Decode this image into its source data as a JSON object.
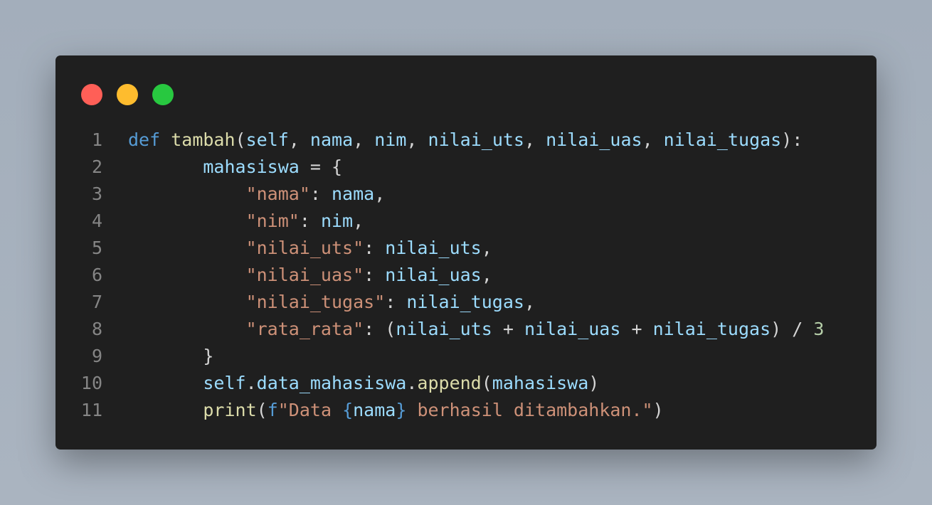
{
  "window": {
    "traffic_lights": {
      "close_color": "#ff5f57",
      "minimize_color": "#febc2e",
      "maximize_color": "#28c840"
    }
  },
  "editor": {
    "lines": [
      {
        "number": "1",
        "indent": "",
        "tokens": [
          {
            "text": "def",
            "type": "kw"
          },
          {
            "text": " ",
            "type": "pn"
          },
          {
            "text": "tambah",
            "type": "fn"
          },
          {
            "text": "(",
            "type": "pn"
          },
          {
            "text": "self",
            "type": "var"
          },
          {
            "text": ", ",
            "type": "pn"
          },
          {
            "text": "nama",
            "type": "var"
          },
          {
            "text": ", ",
            "type": "pn"
          },
          {
            "text": "nim",
            "type": "var"
          },
          {
            "text": ", ",
            "type": "pn"
          },
          {
            "text": "nilai_uts",
            "type": "var"
          },
          {
            "text": ", ",
            "type": "pn"
          },
          {
            "text": "nilai_uas",
            "type": "var"
          },
          {
            "text": ", ",
            "type": "pn"
          },
          {
            "text": "nilai_tugas",
            "type": "var"
          },
          {
            "text": "):",
            "type": "pn"
          }
        ]
      },
      {
        "number": "2",
        "indent": "       ",
        "tokens": [
          {
            "text": "mahasiswa",
            "type": "var"
          },
          {
            "text": " = {",
            "type": "pn"
          }
        ]
      },
      {
        "number": "3",
        "indent": "           ",
        "tokens": [
          {
            "text": "\"nama\"",
            "type": "str"
          },
          {
            "text": ": ",
            "type": "pn"
          },
          {
            "text": "nama",
            "type": "var"
          },
          {
            "text": ",",
            "type": "pn"
          }
        ]
      },
      {
        "number": "4",
        "indent": "           ",
        "tokens": [
          {
            "text": "\"nim\"",
            "type": "str"
          },
          {
            "text": ": ",
            "type": "pn"
          },
          {
            "text": "nim",
            "type": "var"
          },
          {
            "text": ",",
            "type": "pn"
          }
        ]
      },
      {
        "number": "5",
        "indent": "           ",
        "tokens": [
          {
            "text": "\"nilai_uts\"",
            "type": "str"
          },
          {
            "text": ": ",
            "type": "pn"
          },
          {
            "text": "nilai_uts",
            "type": "var"
          },
          {
            "text": ",",
            "type": "pn"
          }
        ]
      },
      {
        "number": "6",
        "indent": "           ",
        "tokens": [
          {
            "text": "\"nilai_uas\"",
            "type": "str"
          },
          {
            "text": ": ",
            "type": "pn"
          },
          {
            "text": "nilai_uas",
            "type": "var"
          },
          {
            "text": ",",
            "type": "pn"
          }
        ]
      },
      {
        "number": "7",
        "indent": "           ",
        "tokens": [
          {
            "text": "\"nilai_tugas\"",
            "type": "str"
          },
          {
            "text": ": ",
            "type": "pn"
          },
          {
            "text": "nilai_tugas",
            "type": "var"
          },
          {
            "text": ",",
            "type": "pn"
          }
        ]
      },
      {
        "number": "8",
        "indent": "           ",
        "tokens": [
          {
            "text": "\"rata_rata\"",
            "type": "str"
          },
          {
            "text": ": (",
            "type": "pn"
          },
          {
            "text": "nilai_uts",
            "type": "var"
          },
          {
            "text": " + ",
            "type": "pn"
          },
          {
            "text": "nilai_uas",
            "type": "var"
          },
          {
            "text": " + ",
            "type": "pn"
          },
          {
            "text": "nilai_tugas",
            "type": "var"
          },
          {
            "text": ") / ",
            "type": "pn"
          },
          {
            "text": "3",
            "type": "num"
          }
        ]
      },
      {
        "number": "9",
        "indent": "       ",
        "tokens": [
          {
            "text": "}",
            "type": "pn"
          }
        ]
      },
      {
        "number": "10",
        "indent": "       ",
        "tokens": [
          {
            "text": "self",
            "type": "var"
          },
          {
            "text": ".",
            "type": "pn"
          },
          {
            "text": "data_mahasiswa",
            "type": "var"
          },
          {
            "text": ".",
            "type": "pn"
          },
          {
            "text": "append",
            "type": "fn"
          },
          {
            "text": "(",
            "type": "pn"
          },
          {
            "text": "mahasiswa",
            "type": "var"
          },
          {
            "text": ")",
            "type": "pn"
          }
        ]
      },
      {
        "number": "11",
        "indent": "       ",
        "tokens": [
          {
            "text": "print",
            "type": "fn"
          },
          {
            "text": "(",
            "type": "pn"
          },
          {
            "text": "f",
            "type": "kw"
          },
          {
            "text": "\"Data ",
            "type": "str"
          },
          {
            "text": "{",
            "type": "kw"
          },
          {
            "text": "nama",
            "type": "var"
          },
          {
            "text": "}",
            "type": "kw"
          },
          {
            "text": " berhasil ditambahkan.\"",
            "type": "str"
          },
          {
            "text": ")",
            "type": "pn"
          }
        ]
      }
    ]
  }
}
